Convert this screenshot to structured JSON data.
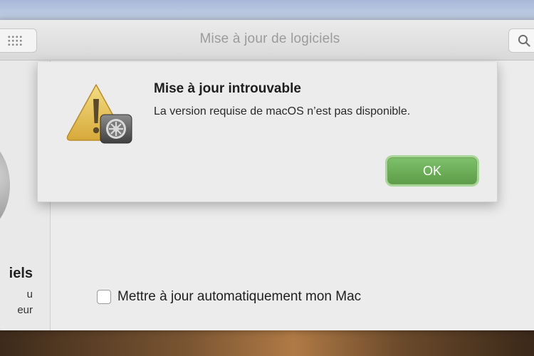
{
  "window": {
    "title": "Mise à jour de logiciels"
  },
  "toolbar": {
    "grid_icon": "grid-icon",
    "search_icon": "search-icon"
  },
  "sidebar": {
    "title_partial": "iels",
    "desc_line1_partial": "u",
    "desc_line2_partial": "eur"
  },
  "settings": {
    "auto_update_label": "Mettre à jour automatiquement mon Mac",
    "auto_update_checked": false
  },
  "alert": {
    "icon": "caution-icon",
    "title": "Mise à jour introuvable",
    "message": "La version requise de macOS n’est pas disponible.",
    "ok_label": "OK",
    "ok_color": "#5e9d49"
  }
}
